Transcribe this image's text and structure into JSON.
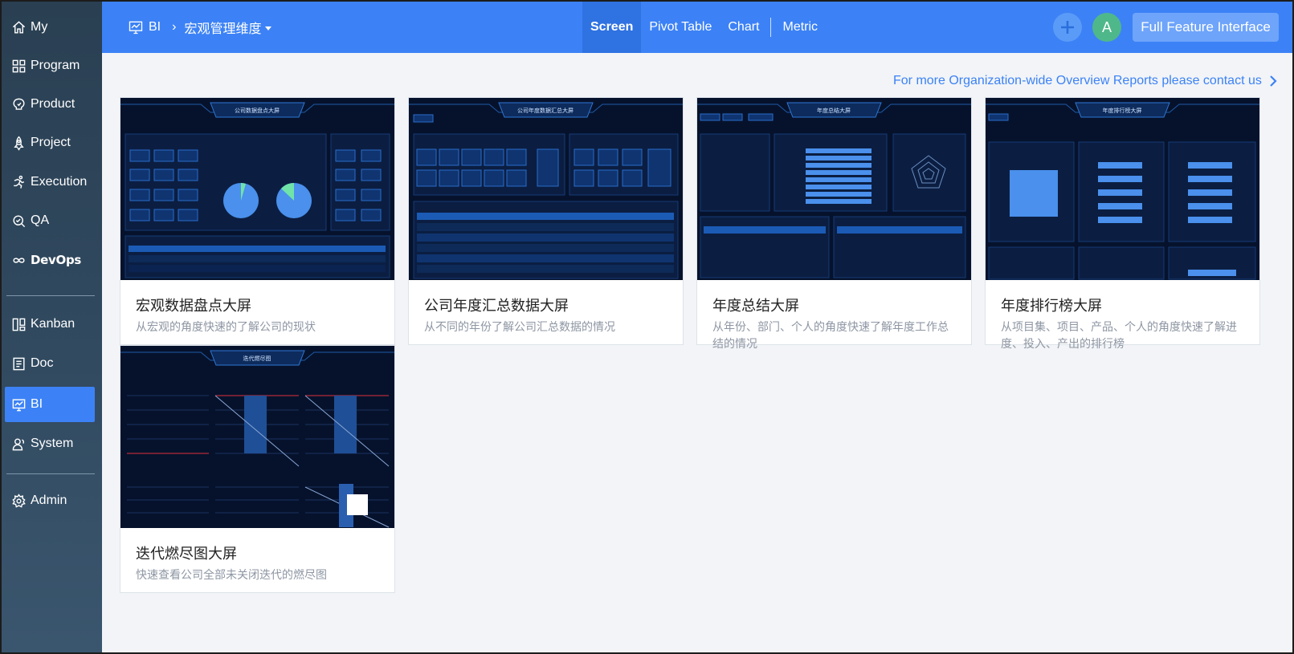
{
  "sidebar": {
    "items": [
      {
        "label": "My",
        "icon": "home-icon"
      },
      {
        "label": "Program",
        "icon": "program-icon"
      },
      {
        "label": "Product",
        "icon": "product-icon"
      },
      {
        "label": "Project",
        "icon": "project-icon"
      },
      {
        "label": "Execution",
        "icon": "execution-icon"
      },
      {
        "label": "QA",
        "icon": "qa-icon"
      },
      {
        "label": "DevOps",
        "icon": "devops-icon"
      },
      {
        "label": "Kanban",
        "icon": "kanban-icon"
      },
      {
        "label": "Doc",
        "icon": "doc-icon"
      },
      {
        "label": "BI",
        "icon": "bi-icon",
        "active": true
      },
      {
        "label": "System",
        "icon": "system-icon"
      },
      {
        "label": "Admin",
        "icon": "admin-icon"
      }
    ]
  },
  "header": {
    "breadcrumb_root": "BI",
    "breadcrumb_current": "宏观管理维度",
    "tabs": [
      {
        "label": "Screen",
        "active": true
      },
      {
        "label": "Pivot Table"
      },
      {
        "label": "Chart"
      },
      {
        "label": "Metric"
      }
    ],
    "avatar_initial": "A",
    "full_feature_label": "Full Feature Interface",
    "accent_color": "#3c82f6"
  },
  "main": {
    "contact_link": "For more Organization-wide Overview Reports please contact us",
    "cards": [
      {
        "title": "宏观数据盘点大屏",
        "desc": "从宏观的角度快速的了解公司的现状",
        "thumb_title": "公司数据盘点大屏"
      },
      {
        "title": "公司年度汇总数据大屏",
        "desc": "从不同的年份了解公司汇总数据的情况",
        "thumb_title": "公司年度数据汇总大屏"
      },
      {
        "title": "年度总结大屏",
        "desc": "从年份、部门、个人的角度快速了解年度工作总结的情况",
        "thumb_title": "年度总结大屏"
      },
      {
        "title": "年度排行榜大屏",
        "desc": "从项目集、项目、产品、个人的角度快速了解进度、投入、产出的排行榜",
        "thumb_title": "年度排行榜大屏"
      },
      {
        "title": "迭代燃尽图大屏",
        "desc": "快速查看公司全部未关闭迭代的燃尽图",
        "thumb_title": "迭代燃尽图"
      }
    ]
  }
}
